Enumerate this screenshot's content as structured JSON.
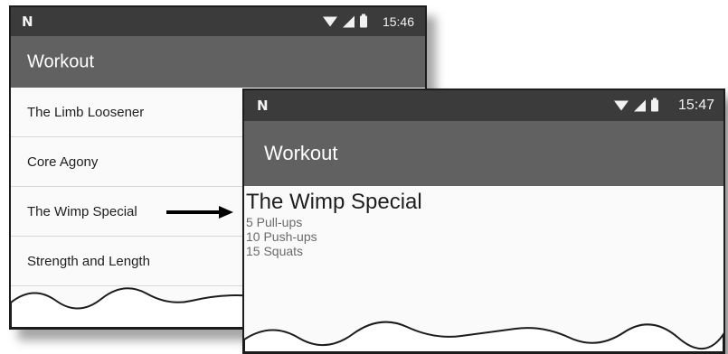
{
  "list_screen": {
    "status_time": "15:46",
    "title": "Workout",
    "items": [
      {
        "label": "The Limb Loosener"
      },
      {
        "label": "Core Agony"
      },
      {
        "label": "The Wimp Special"
      },
      {
        "label": "Strength and Length"
      }
    ]
  },
  "detail_screen": {
    "status_time": "15:47",
    "title": "Workout",
    "workout_name": "The Wimp Special",
    "exercises": [
      "5 Pull-ups",
      "10 Push-ups",
      "15 Squats"
    ]
  },
  "icons": [
    "n-logo-icon",
    "wifi-icon",
    "signal-icon",
    "battery-icon",
    "arrow-icon"
  ],
  "colors": {
    "statusbar": "#3b3b3b",
    "toolbar": "#616161",
    "background": "#fafafa"
  }
}
